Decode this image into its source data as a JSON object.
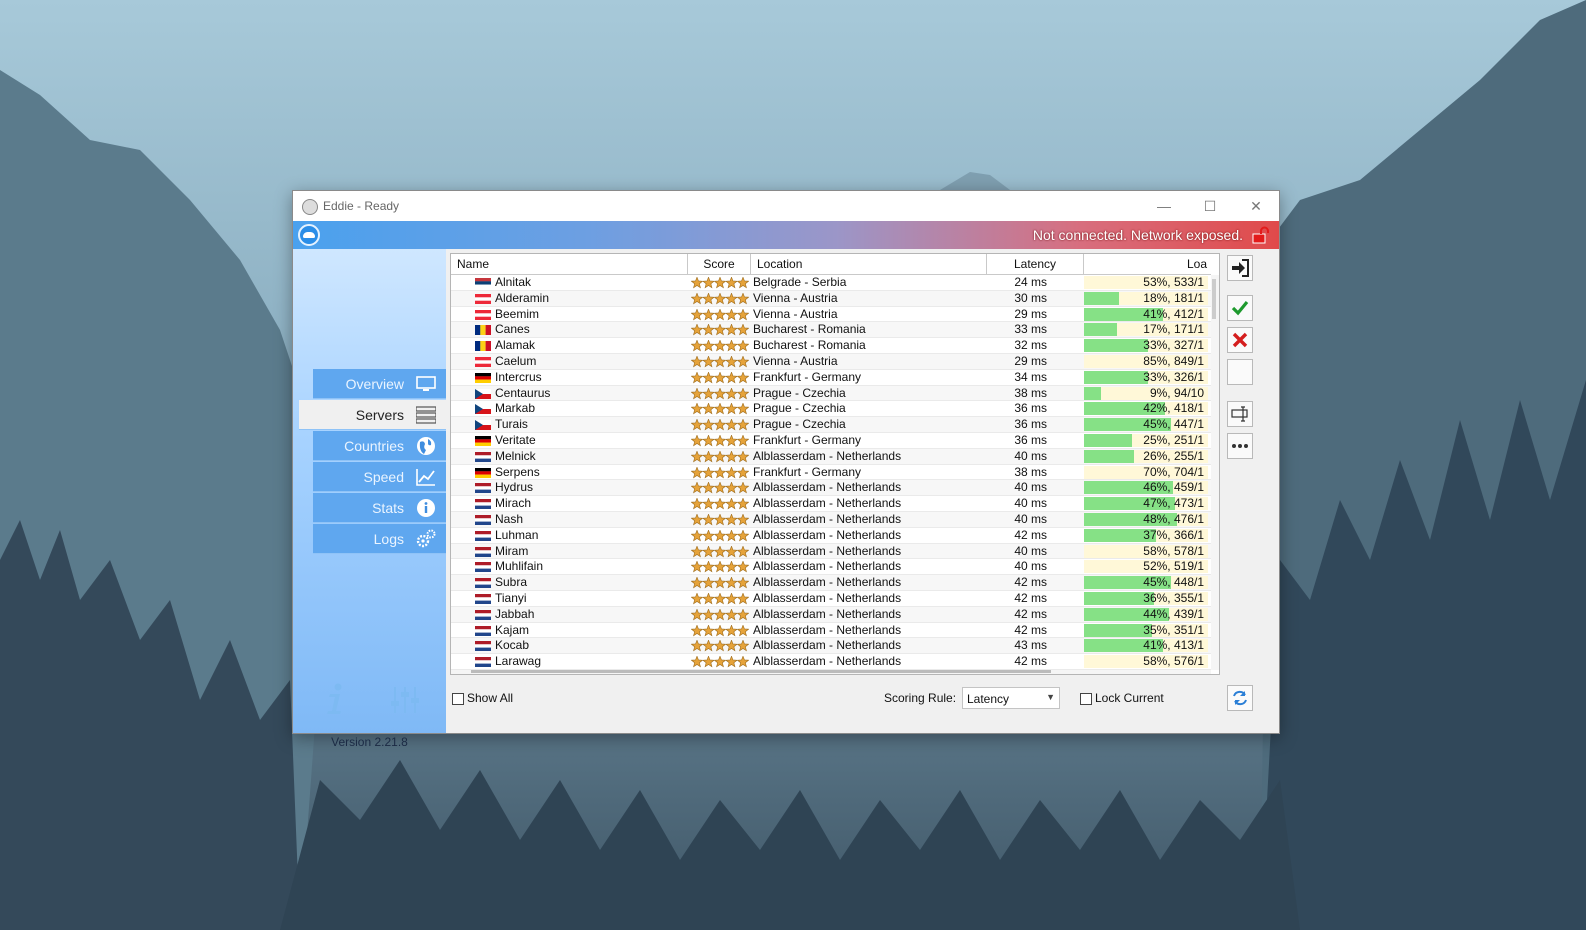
{
  "window": {
    "title": "Eddie - Ready",
    "status": "Not connected. Network exposed.",
    "controls": {
      "minimize": "—",
      "maximize": "☐",
      "close": "✕"
    }
  },
  "sidebar": {
    "items": [
      {
        "label": "Overview",
        "icon": "monitor-icon"
      },
      {
        "label": "Servers",
        "icon": "server-list-icon"
      },
      {
        "label": "Countries",
        "icon": "globe-icon"
      },
      {
        "label": "Speed",
        "icon": "chart-icon"
      },
      {
        "label": "Stats",
        "icon": "info-icon"
      },
      {
        "label": "Logs",
        "icon": "gears-icon"
      }
    ],
    "version": "Version 2.21.8"
  },
  "table": {
    "headers": {
      "name": "Name",
      "score": "Score",
      "location": "Location",
      "latency": "Latency",
      "load": "Loa"
    },
    "rows": [
      {
        "name": "Alnitak",
        "flag": "rs",
        "location": "Belgrade - Serbia",
        "latency": "24 ms",
        "load": "53%, 533/1",
        "pct": 53
      },
      {
        "name": "Alderamin",
        "flag": "at",
        "location": "Vienna - Austria",
        "latency": "30 ms",
        "load": "18%, 181/1",
        "pct": 18
      },
      {
        "name": "Beemim",
        "flag": "at",
        "location": "Vienna - Austria",
        "latency": "29 ms",
        "load": "41%, 412/1",
        "pct": 41
      },
      {
        "name": "Canes",
        "flag": "ro",
        "location": "Bucharest - Romania",
        "latency": "33 ms",
        "load": "17%, 171/1",
        "pct": 17
      },
      {
        "name": "Alamak",
        "flag": "ro",
        "location": "Bucharest - Romania",
        "latency": "32 ms",
        "load": "33%, 327/1",
        "pct": 33
      },
      {
        "name": "Caelum",
        "flag": "at",
        "location": "Vienna - Austria",
        "latency": "29 ms",
        "load": "85%, 849/1",
        "pct": 85
      },
      {
        "name": "Intercrus",
        "flag": "de",
        "location": "Frankfurt - Germany",
        "latency": "34 ms",
        "load": "33%, 326/1",
        "pct": 33
      },
      {
        "name": "Centaurus",
        "flag": "cz",
        "location": "Prague - Czechia",
        "latency": "38 ms",
        "load": "9%, 94/10",
        "pct": 9
      },
      {
        "name": "Markab",
        "flag": "cz",
        "location": "Prague - Czechia",
        "latency": "36 ms",
        "load": "42%, 418/1",
        "pct": 42
      },
      {
        "name": "Turais",
        "flag": "cz",
        "location": "Prague - Czechia",
        "latency": "36 ms",
        "load": "45%, 447/1",
        "pct": 45
      },
      {
        "name": "Veritate",
        "flag": "de",
        "location": "Frankfurt - Germany",
        "latency": "36 ms",
        "load": "25%, 251/1",
        "pct": 25
      },
      {
        "name": "Melnick",
        "flag": "nl",
        "location": "Alblasserdam - Netherlands",
        "latency": "40 ms",
        "load": "26%, 255/1",
        "pct": 26
      },
      {
        "name": "Serpens",
        "flag": "de",
        "location": "Frankfurt - Germany",
        "latency": "38 ms",
        "load": "70%, 704/1",
        "pct": 70
      },
      {
        "name": "Hydrus",
        "flag": "nl",
        "location": "Alblasserdam - Netherlands",
        "latency": "40 ms",
        "load": "46%, 459/1",
        "pct": 46
      },
      {
        "name": "Mirach",
        "flag": "nl",
        "location": "Alblasserdam - Netherlands",
        "latency": "40 ms",
        "load": "47%, 473/1",
        "pct": 47
      },
      {
        "name": "Nash",
        "flag": "nl",
        "location": "Alblasserdam - Netherlands",
        "latency": "40 ms",
        "load": "48%, 476/1",
        "pct": 48
      },
      {
        "name": "Luhman",
        "flag": "nl",
        "location": "Alblasserdam - Netherlands",
        "latency": "42 ms",
        "load": "37%, 366/1",
        "pct": 37
      },
      {
        "name": "Miram",
        "flag": "nl",
        "location": "Alblasserdam - Netherlands",
        "latency": "40 ms",
        "load": "58%, 578/1",
        "pct": 58
      },
      {
        "name": "Muhlifain",
        "flag": "nl",
        "location": "Alblasserdam - Netherlands",
        "latency": "40 ms",
        "load": "52%, 519/1",
        "pct": 52
      },
      {
        "name": "Subra",
        "flag": "nl",
        "location": "Alblasserdam - Netherlands",
        "latency": "42 ms",
        "load": "45%, 448/1",
        "pct": 45
      },
      {
        "name": "Tianyi",
        "flag": "nl",
        "location": "Alblasserdam - Netherlands",
        "latency": "42 ms",
        "load": "36%, 355/1",
        "pct": 36
      },
      {
        "name": "Jabbah",
        "flag": "nl",
        "location": "Alblasserdam - Netherlands",
        "latency": "42 ms",
        "load": "44%, 439/1",
        "pct": 44
      },
      {
        "name": "Kajam",
        "flag": "nl",
        "location": "Alblasserdam - Netherlands",
        "latency": "42 ms",
        "load": "35%, 351/1",
        "pct": 35
      },
      {
        "name": "Kocab",
        "flag": "nl",
        "location": "Alblasserdam - Netherlands",
        "latency": "43 ms",
        "load": "41%, 413/1",
        "pct": 41
      },
      {
        "name": "Larawag",
        "flag": "nl",
        "location": "Alblasserdam - Netherlands",
        "latency": "42 ms",
        "load": "58%, 576/1",
        "pct": 58
      }
    ]
  },
  "toolbar": {
    "connect": "connect-icon",
    "allow": "checkmark-icon",
    "deny": "cross-icon",
    "blank": "blank-icon",
    "rename": "rename-icon",
    "more": "more-icon",
    "refresh": "refresh-icon"
  },
  "footer": {
    "show_all": "Show All",
    "scoring_label": "Scoring Rule:",
    "scoring_value": "Latency",
    "lock_current": "Lock Current"
  },
  "colors": {
    "header_left": "#4aa1ee",
    "header_right": "#e04a4a",
    "nav": "#5fa7ef",
    "load_bar": "#86e186",
    "load_bg": "#fff8d8",
    "star": "#e6a33a"
  }
}
